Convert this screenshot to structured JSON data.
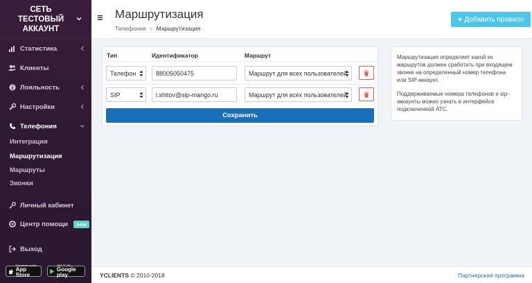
{
  "sidebar": {
    "account_name": "СЕТЬ ТЕСТОВЫЙ АККАУНТ",
    "items": [
      {
        "label": "Статистика"
      },
      {
        "label": "Клиенты"
      },
      {
        "label": "Лояльность"
      },
      {
        "label": "Настройки"
      },
      {
        "label": "Телефония"
      },
      {
        "label": "Личный кабинет"
      },
      {
        "label": "Центр помощи"
      },
      {
        "label": "Выход"
      }
    ],
    "subitems": [
      {
        "label": "Интеграция"
      },
      {
        "label": "Маршрутизация"
      },
      {
        "label": "Маршруты"
      },
      {
        "label": "Звонки"
      }
    ],
    "new_badge": "new",
    "app_store": {
      "small": "Download on the",
      "big": "App Store"
    },
    "google_play": {
      "small": "GET IT ON",
      "big": "Google play"
    }
  },
  "header": {
    "title": "Маршрутизация",
    "breadcrumb": [
      "Телефония",
      "Маршрутизация"
    ],
    "breadcrumb_sep": ">",
    "add_button": "Добавить правило"
  },
  "table": {
    "columns": [
      "Тип",
      "Идентификатор",
      "Маршрут"
    ],
    "rows": [
      {
        "type": "Телефон",
        "identifier": "88005050475",
        "route": "Маршрут для всех пользователей"
      },
      {
        "type": "SIP",
        "identifier": "l.shitov@sip-mango.ru",
        "route": "Маршрут для всех пользователей"
      }
    ],
    "save_button": "Сохранить"
  },
  "info": {
    "p1": "Маршрутизация определяет какой из маршрутов должен сработать при входящем звонке на определенный номер телефона или SIP-аккаунт.",
    "p2": "Поддерживаемые номера телефонов и sip-аккаунты можно узнать в интерфейсе подключенной АТС."
  },
  "footer": {
    "brand": "YCLIENTS",
    "copyright": "© 2010-2018",
    "partner_link": "Партнерская программа"
  },
  "colors": {
    "sidebar_bg": "#3a1c3c",
    "accent_button": "#4dc6ea",
    "save_button": "#1a6fb9",
    "delete_border": "#e45b5b",
    "link": "#2a6fb5"
  }
}
